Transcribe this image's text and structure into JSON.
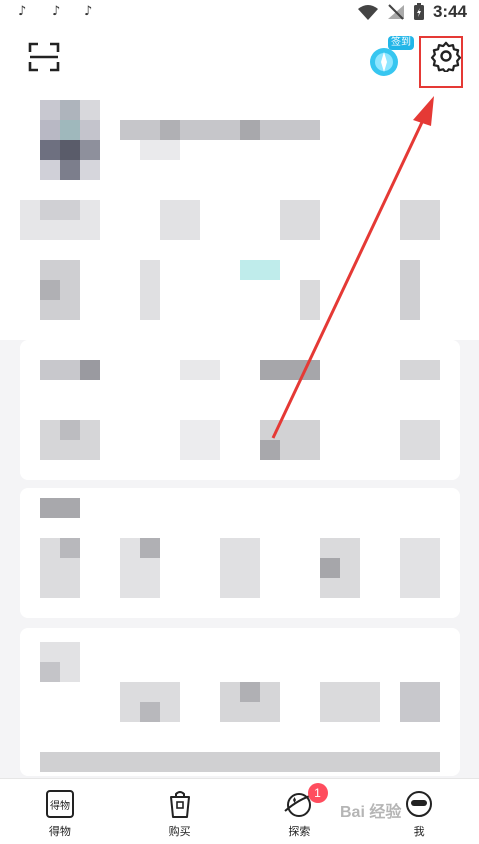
{
  "status_bar": {
    "time": "3:44",
    "notification_icons": [
      "tiktok-icon",
      "tiktok-icon",
      "tiktok-icon"
    ]
  },
  "header": {
    "sign_in_badge": "签到"
  },
  "tabs": [
    {
      "label": "得物",
      "icon": "dewu-icon"
    },
    {
      "label": "购买",
      "icon": "bag-icon"
    },
    {
      "label": "探索",
      "icon": "planet-icon",
      "badge": "1"
    },
    {
      "label": "我",
      "icon": "profile-icon"
    }
  ],
  "watermark": "Bai 经验",
  "colors": {
    "accent_blue": "#22b6e8",
    "highlight_red": "#e53935",
    "badge_red": "#ff4d5e"
  }
}
